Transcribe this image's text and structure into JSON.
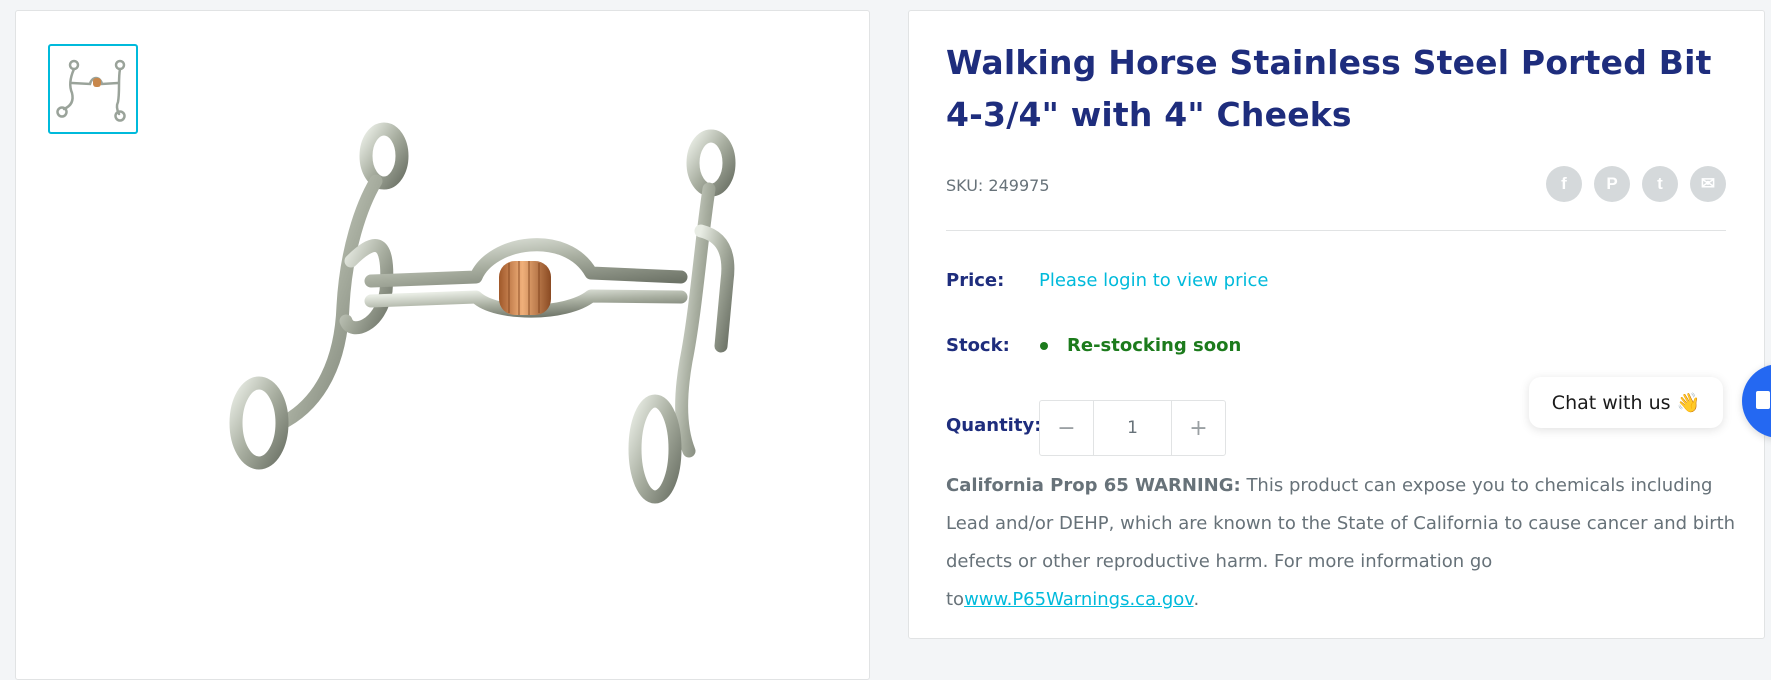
{
  "product": {
    "title": "Walking Horse Stainless Steel Ported Bit 4-3/4\" with 4\" Cheeks",
    "sku_label": "SKU:",
    "sku_value": "249975",
    "price_label": "Price:",
    "price_value": "Please login to view price",
    "stock_label": "Stock:",
    "stock_value": "Re-stocking soon",
    "quantity_label": "Quantity:",
    "quantity_value": "1",
    "quantity_decrease": "−",
    "quantity_increase": "+"
  },
  "share": {
    "icons": [
      "facebook-icon",
      "pinterest-icon",
      "twitter-icon",
      "email-icon"
    ],
    "glyphs": [
      "f",
      "P",
      "t",
      "✉"
    ]
  },
  "warning": {
    "strong": "California Prop 65 WARNING:",
    "text": " This product can expose you to chemicals including Lead and/or DEHP, which are known to the State of California to cause cancer and birth defects or other reproductive harm. For more information go to",
    "link": "www.P65Warnings.ca.gov",
    "suffix": "."
  },
  "chat": {
    "label": "Chat with us",
    "emoji": "👋"
  },
  "colors": {
    "title": "#1e2d7d",
    "accent": "#00badb",
    "stock": "#1c7b1c",
    "muted": "#677279",
    "chat_fab": "#2468f2"
  }
}
